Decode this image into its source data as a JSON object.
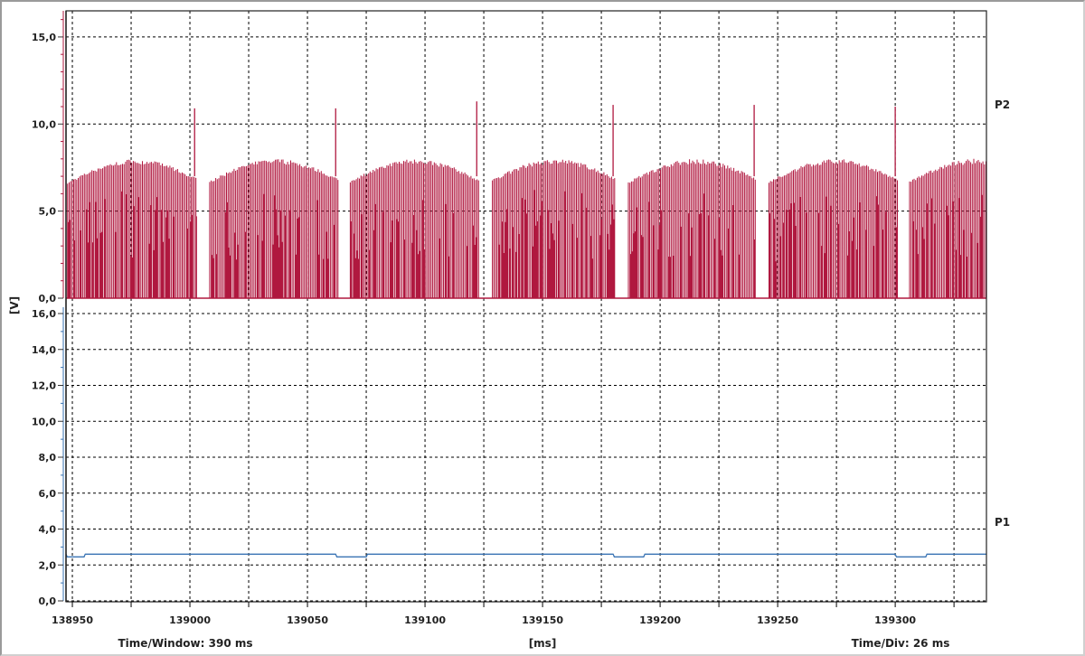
{
  "chart_data": {
    "type": "line",
    "x_unit_label": "[ms]",
    "y_unit_label": "[V]",
    "xlim": [
      138947.3,
      139338.8
    ],
    "x_ticks": [
      "138950",
      "139000",
      "139050",
      "139100",
      "139150",
      "139200",
      "139250",
      "139300"
    ],
    "x_tick_values": [
      138950,
      139000,
      139050,
      139100,
      139150,
      139200,
      139250,
      139300
    ],
    "footer": {
      "left": "Time/Window: 390 ms",
      "center": "[ms]",
      "right": "Time/Div: 26 ms"
    },
    "grid": true,
    "panels": [
      {
        "name": "P2",
        "color": "#b0183f",
        "ylim": [
          0,
          16.5
        ],
        "y_ticks": [
          "0,0",
          "5,0",
          "10,0",
          "15,0"
        ],
        "y_tick_values": [
          0,
          5,
          10,
          15
        ],
        "description_values": {
          "pulse_min_v": 0.0,
          "pulse_max_v_range": [
            6.0,
            8.0
          ],
          "pulse_period_ms": 1.3
        },
        "spikes": [
          {
            "t": 139002,
            "v": 10.9
          },
          {
            "t": 139062,
            "v": 10.9
          },
          {
            "t": 139122,
            "v": 11.3
          },
          {
            "t": 139180,
            "v": 11.1
          },
          {
            "t": 139240,
            "v": 11.1
          },
          {
            "t": 139300,
            "v": 11.0
          }
        ],
        "gaps_ms": [
          [
            139003,
            139008
          ],
          [
            139063,
            139068
          ],
          [
            139123,
            139128
          ],
          [
            139181,
            139186
          ],
          [
            139241,
            139246
          ],
          [
            139301,
            139306
          ]
        ]
      },
      {
        "name": "P1",
        "color": "#3a74b4",
        "ylim": [
          0,
          16.0
        ],
        "y_ticks": [
          "0,0",
          "2,0",
          "4,0",
          "6,0",
          "8,0",
          "10,0",
          "12,0",
          "14,0",
          "16,0"
        ],
        "y_tick_values": [
          0,
          2,
          4,
          6,
          8,
          10,
          12,
          14,
          16
        ],
        "baseline_v": 2.6,
        "dips": [
          {
            "t_start": 138947.3,
            "t_end": 138955,
            "v": 2.45
          },
          {
            "t_start": 139062,
            "t_end": 139075,
            "v": 2.45
          },
          {
            "t_start": 139180,
            "t_end": 139193,
            "v": 2.45
          },
          {
            "t_start": 139300,
            "t_end": 139313,
            "v": 2.45
          }
        ]
      }
    ]
  }
}
